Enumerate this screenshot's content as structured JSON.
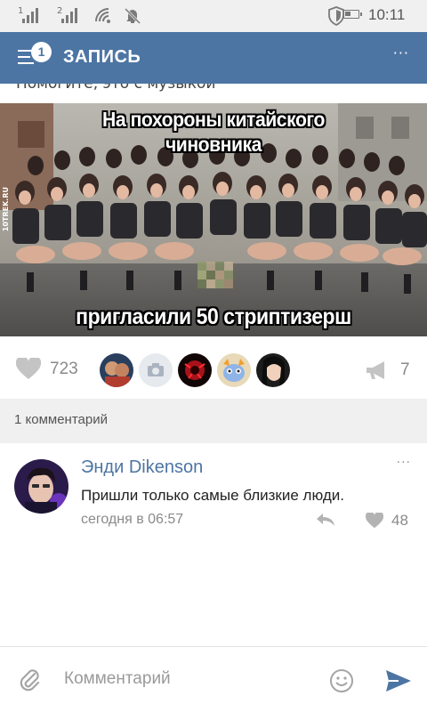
{
  "status_bar": {
    "sim1_label": "1",
    "sim2_label": "2",
    "time": "10:11",
    "battery_level": 0.45
  },
  "header": {
    "menu_icon": "hamburger-menu-icon",
    "notification_count": "1",
    "title": "ЗАПИСЬ",
    "more_icon": "more-dots-icon"
  },
  "post": {
    "cut_text": "Помогите, это с музыкой",
    "image": {
      "caption_top_line1": "На похороны китайского",
      "caption_top_line2": "чиновника",
      "caption_bottom": "пригласили 50 стриптизерш",
      "watermark": "10TREK.RU"
    },
    "likes": {
      "count": "723",
      "icon": "heart-icon"
    },
    "likers": [
      {
        "name": "liker-1-avatar"
      },
      {
        "name": "liker-2-camera",
        "icon": "camera-icon"
      },
      {
        "name": "liker-3-avatar"
      },
      {
        "name": "liker-4-avatar"
      },
      {
        "name": "liker-5-avatar"
      }
    ],
    "shares": {
      "count": "7",
      "icon": "megaphone-icon"
    }
  },
  "comments": {
    "header": "1 комментарий",
    "items": [
      {
        "author": "Энди Dikenson",
        "text": "Пришли только самые близкие люди.",
        "date": "сегодня в 06:57",
        "likes": "48"
      }
    ]
  },
  "composer": {
    "placeholder": "Комментарий",
    "attach_icon": "paperclip-icon",
    "emoji_icon": "smiley-icon",
    "send_icon": "send-icon"
  },
  "colors": {
    "accent": "#4d75a3",
    "background": "#ffffff",
    "section_bg": "#f0f0f0",
    "muted_text": "#8a8a8a"
  }
}
